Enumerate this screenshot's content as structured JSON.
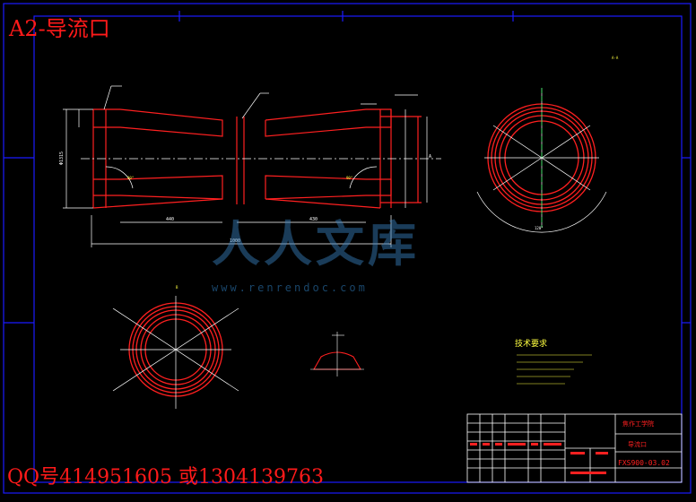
{
  "drawing": {
    "title": "A2-导流口",
    "contact": "QQ号414951605 或1304139763",
    "watermark": {
      "logo_text": "人人文库",
      "site": "www.renrendoc.com"
    },
    "title_block": {
      "school": "焦作工学院",
      "part_name": "导流口",
      "drawing_no": "FXS900-03.02"
    },
    "tech_requirements": {
      "heading": "技术要求"
    },
    "colors": {
      "background": "#000000",
      "frame": "#1a1aff",
      "part_lines": "#ff2020",
      "dimensions": "#ffffff",
      "centerline": "#00ff40",
      "annotation": "#ffff40",
      "watermark": "#3a86c6"
    }
  }
}
